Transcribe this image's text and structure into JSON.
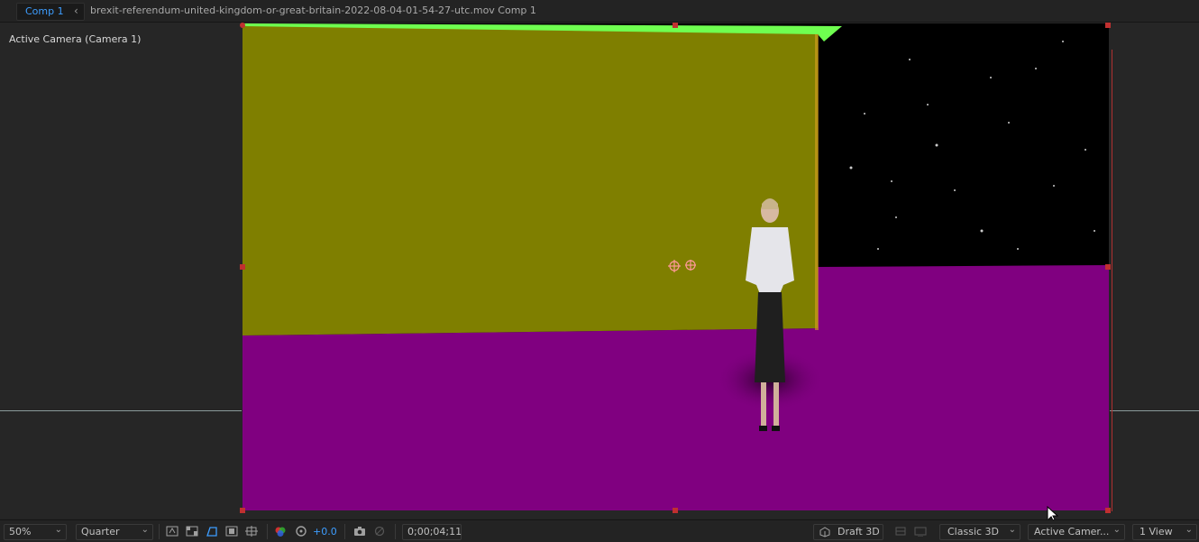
{
  "tabs": {
    "active_tab": "Comp 1",
    "breadcrumb": "brexit-referendum-united-kingdom-or-great-britain-2022-08-04-01-54-27-utc.mov Comp 1"
  },
  "viewer": {
    "camera_label": "Active Camera (Camera 1)"
  },
  "toolbar": {
    "zoom": "50%",
    "resolution": "Quarter",
    "exposure": "+0.0",
    "timecode": "0;00;04;11",
    "renderer": "Draft 3D",
    "renderer_mode": "Classic 3D",
    "view_camera": "Active Camer...",
    "view_layout": "1 View"
  },
  "icons": {
    "back": "chevron-left-icon",
    "cursor": "mouse-cursor-icon"
  },
  "colors": {
    "accent": "#3d9dff",
    "wall": "#7f7f00",
    "floor": "#800080",
    "green_edge": "#6fff50",
    "handles": "#c03030"
  }
}
